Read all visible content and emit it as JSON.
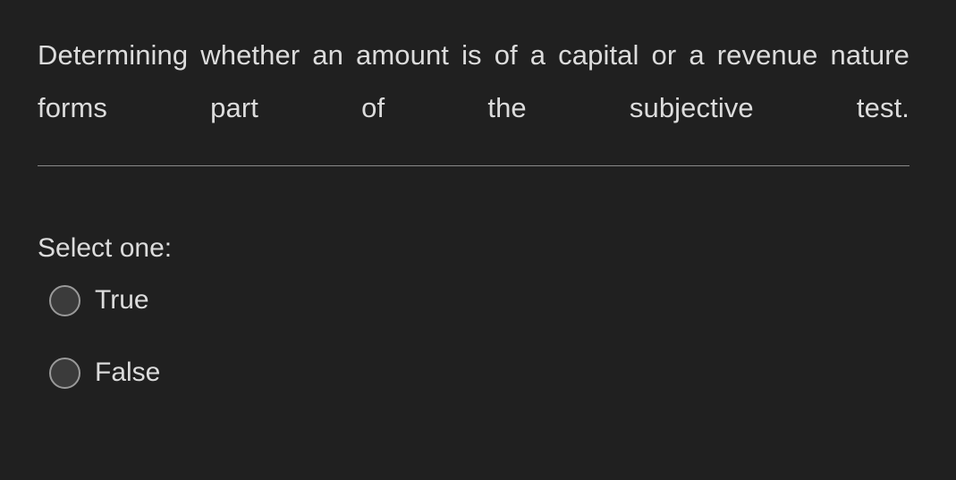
{
  "question": {
    "text": "Determining whether an amount is of a capital or a revenue nature forms part of the subjective test."
  },
  "answer": {
    "prompt": "Select one:",
    "options": [
      {
        "label": "True",
        "selected": false
      },
      {
        "label": "False",
        "selected": false
      }
    ]
  },
  "colors": {
    "background": "#202020",
    "text": "#dcdcdc",
    "divider": "#8a8a8a",
    "radio_border": "#9a9a9a",
    "radio_fill": "#3b3b3b"
  }
}
